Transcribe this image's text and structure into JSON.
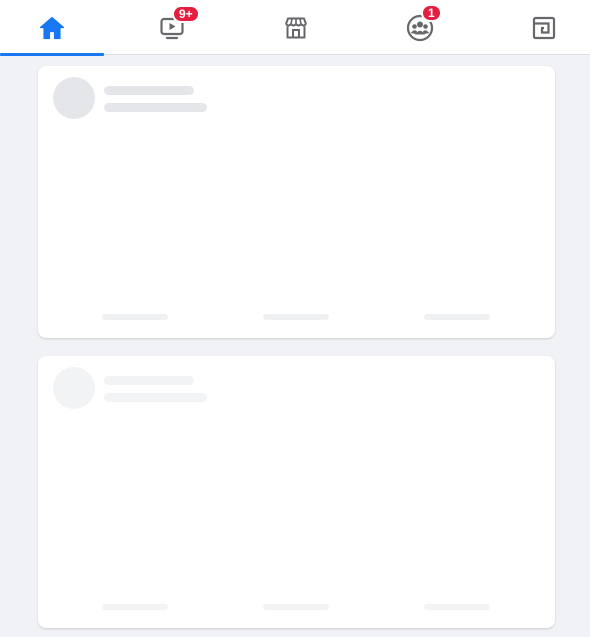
{
  "nav": {
    "tabs": [
      {
        "name": "home",
        "icon": "home-icon",
        "active": true,
        "badge": ""
      },
      {
        "name": "watch",
        "icon": "video-icon",
        "active": false,
        "badge": "9+"
      },
      {
        "name": "marketplace",
        "icon": "marketplace-icon",
        "active": false,
        "badge": ""
      },
      {
        "name": "groups",
        "icon": "groups-icon",
        "active": false,
        "badge": "1"
      },
      {
        "name": "gaming",
        "icon": "gaming-icon",
        "active": false,
        "badge": ""
      }
    ],
    "accent_color": "#1877f2",
    "badge_color": "#e41e3f"
  },
  "feed": {
    "state": "loading",
    "placeholder_cards": 2
  }
}
